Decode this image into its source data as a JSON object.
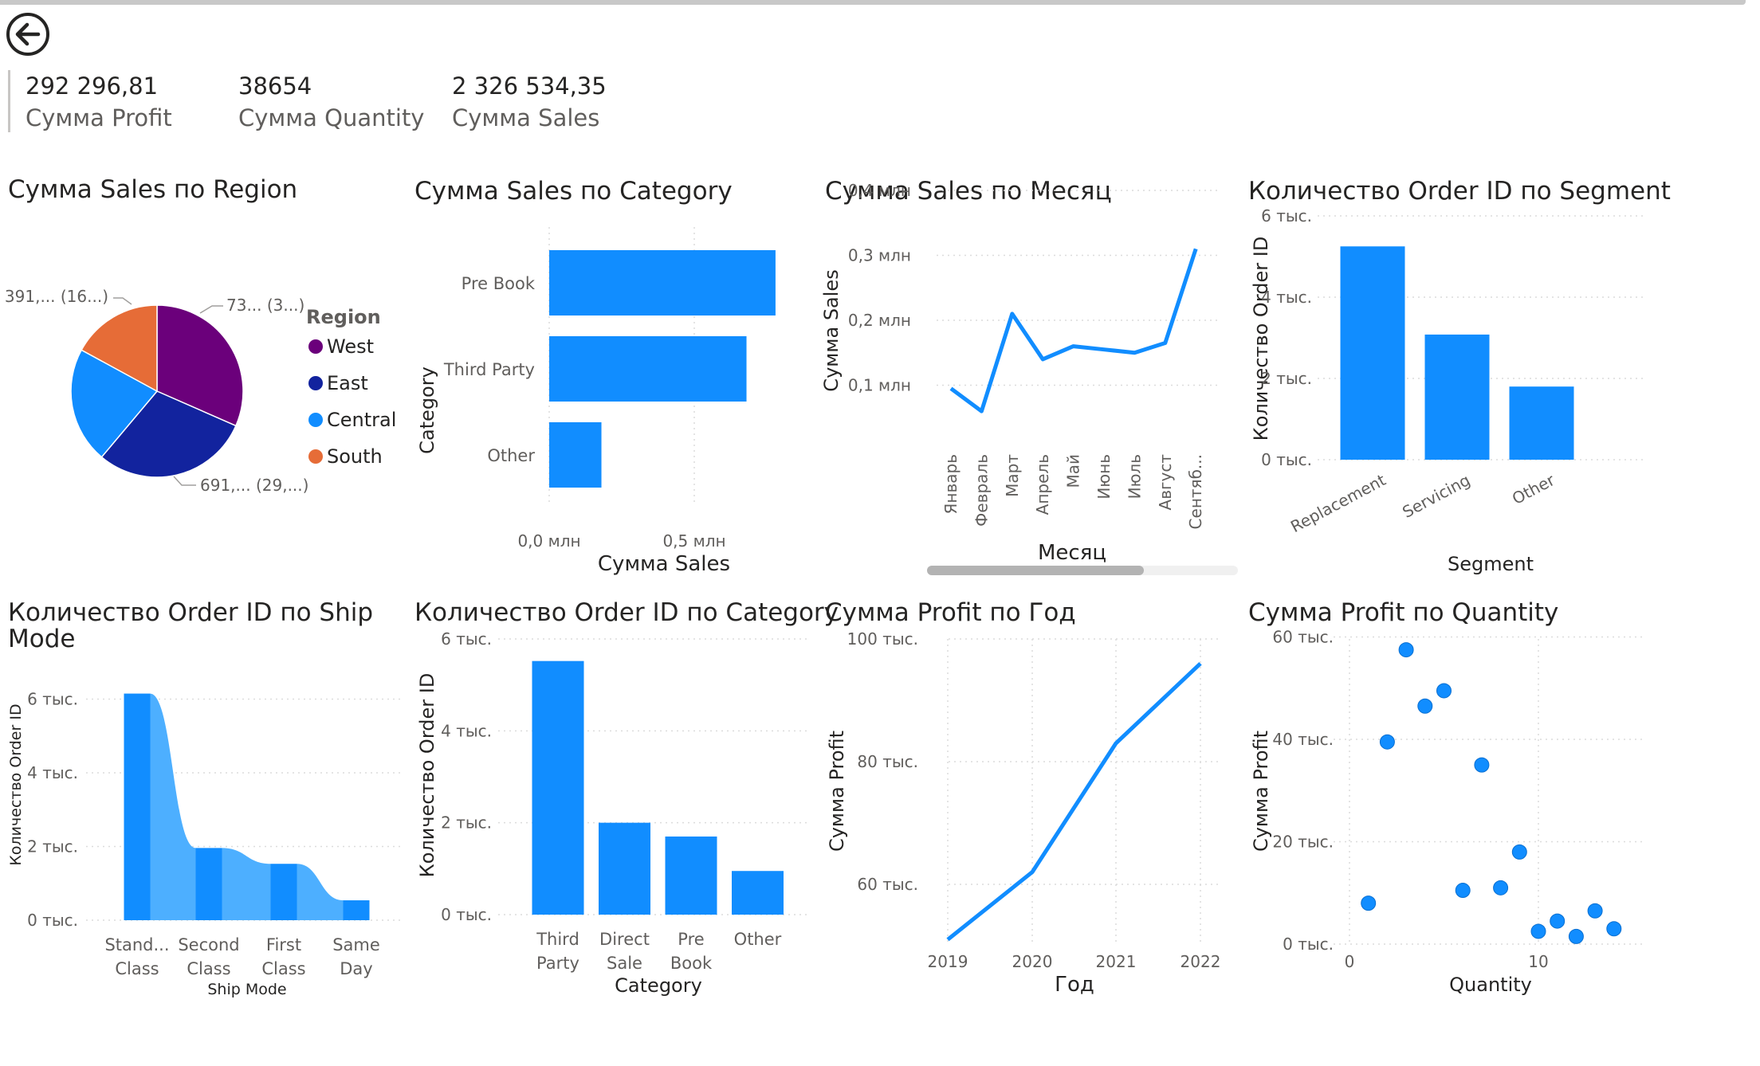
{
  "kpis": [
    {
      "value": "292 296,81",
      "label": "Сумма Profit"
    },
    {
      "value": "38654",
      "label": "Сумма Quantity"
    },
    {
      "value": "2 326 534,35",
      "label": "Сумма Sales"
    }
  ],
  "colors": {
    "primary": "#118DFF",
    "light": "#4DAFFF",
    "west": "#6B007B",
    "east": "#12239E",
    "central": "#118DFF",
    "south": "#E66C37"
  },
  "chart_data": [
    {
      "id": "sales-region",
      "type": "pie",
      "title": "Сумма Sales по Region",
      "legend_title": "Region",
      "legend_position": "right",
      "categories": [
        "West",
        "East",
        "Central",
        "South"
      ],
      "values": [
        725458,
        678781,
        501240,
        391722
      ],
      "data_labels": [
        "73... (3...)",
        "691,... (29,...)",
        "",
        "391,... (16...)"
      ],
      "colors": [
        "#6B007B",
        "#12239E",
        "#118DFF",
        "#E66C37"
      ]
    },
    {
      "id": "sales-category",
      "type": "bar",
      "orientation": "horizontal",
      "title": "Сумма Sales по Category",
      "xlabel": "Сумма Sales",
      "ylabel": "Category",
      "categories": [
        "Pre Book",
        "Third Party",
        "Other"
      ],
      "values": [
        780000,
        680000,
        180000
      ],
      "xlim": [
        0,
        1000000
      ],
      "xticks": [
        "0,0 млн",
        "0,5 млн"
      ]
    },
    {
      "id": "sales-month",
      "type": "line",
      "title": "Сумма Sales по Месяц",
      "xlabel": "Месяц",
      "ylabel": "Сумма Sales",
      "x": [
        "Январь",
        "Февраль",
        "Март",
        "Апрель",
        "Май",
        "Июнь",
        "Июль",
        "Август",
        "Сентяб..."
      ],
      "values": [
        95000,
        60000,
        210000,
        140000,
        160000,
        155000,
        150000,
        165000,
        310000
      ],
      "ylim": [
        0,
        400000
      ],
      "yticks": [
        "0,1 млн",
        "0,2 млн",
        "0,3 млн",
        "0,4 млн"
      ]
    },
    {
      "id": "orders-segment",
      "type": "bar",
      "title": "Количество Order ID по Segment",
      "xlabel": "Segment",
      "ylabel": "Количество Order ID",
      "categories": [
        "Replacement",
        "Servicing",
        "Other"
      ],
      "values": [
        5250,
        3080,
        1800
      ],
      "ylim": [
        0,
        6000
      ],
      "yticks": [
        "0 тыс.",
        "2 тыс.",
        "4 тыс.",
        "6 тыс."
      ]
    },
    {
      "id": "orders-shipmode",
      "type": "bar",
      "title": "Количество Order ID по Ship Mode",
      "xlabel": "Ship Mode",
      "ylabel": "Количество Order ID",
      "categories": [
        "Stand... Class",
        "Second Class",
        "First Class",
        "Same Day"
      ],
      "values": [
        6150,
        1960,
        1530,
        540
      ],
      "ylim": [
        0,
        7000
      ],
      "yticks": [
        "0 тыс.",
        "2 тыс.",
        "4 тыс.",
        "6 тыс."
      ]
    },
    {
      "id": "orders-category",
      "type": "bar",
      "title": "Количество Order ID по Category",
      "xlabel": "Category",
      "ylabel": "Количество Order ID",
      "categories": [
        "Third Party",
        "Direct Sale",
        "Pre Book",
        "Other"
      ],
      "values": [
        5520,
        2000,
        1700,
        950
      ],
      "ylim": [
        0,
        6000
      ],
      "yticks": [
        "0 тыс.",
        "2 тыс.",
        "4 тыс.",
        "6 тыс."
      ]
    },
    {
      "id": "profit-year",
      "type": "line",
      "title": "Сумма Profit по Год",
      "xlabel": "Год",
      "ylabel": "Сумма Profit",
      "x": [
        "2019",
        "2020",
        "2021",
        "2022"
      ],
      "values": [
        51000,
        62000,
        83000,
        96000
      ],
      "ylim": [
        50000,
        100000
      ],
      "yticks": [
        "60 тыс.",
        "80 тыс.",
        "100 тыс."
      ]
    },
    {
      "id": "profit-quantity",
      "type": "scatter",
      "title": "Сумма Profit по Quantity",
      "xlabel": "Quantity",
      "ylabel": "Сумма Profit",
      "points": [
        [
          1,
          8000
        ],
        [
          2,
          39500
        ],
        [
          3,
          57500
        ],
        [
          4,
          46500
        ],
        [
          5,
          49500
        ],
        [
          6,
          10500
        ],
        [
          7,
          35000
        ],
        [
          8,
          11000
        ],
        [
          9,
          18000
        ],
        [
          10,
          2500
        ],
        [
          11,
          4500
        ],
        [
          12,
          1500
        ],
        [
          13,
          6500
        ],
        [
          14,
          3000
        ]
      ],
      "xlim": [
        0,
        15
      ],
      "ylim": [
        0,
        60000
      ],
      "xticks": [
        "0",
        "10"
      ],
      "yticks": [
        "0 тыс.",
        "20 тыс.",
        "40 тыс.",
        "60 тыс."
      ]
    }
  ]
}
